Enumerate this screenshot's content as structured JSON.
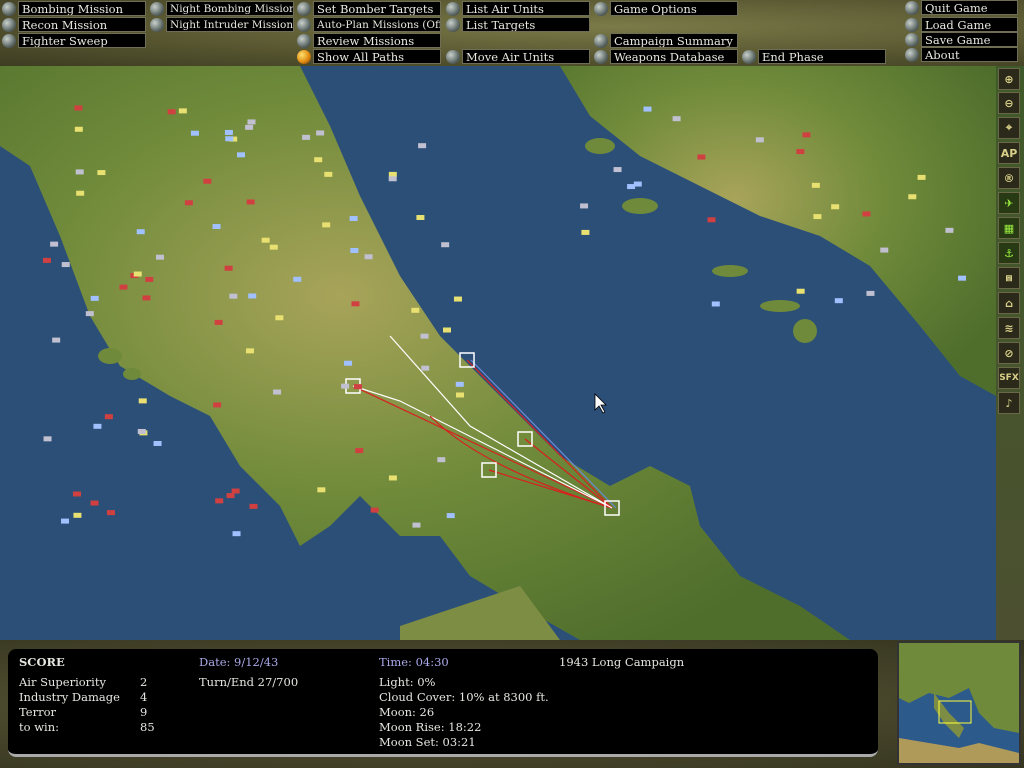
{
  "menu": {
    "bombing_mission": "Bombing Mission",
    "recon_mission": "Recon Mission",
    "fighter_sweep": "Fighter Sweep",
    "night_bombing": "Night Bombing Mission",
    "night_intruder": "Night Intruder Mission",
    "set_bomber_targets": "Set Bomber Targets",
    "auto_plan": "Auto-Plan Missions (Off)",
    "review_missions": "Review Missions",
    "show_all_paths": "Show All Paths",
    "list_air_units": "List Air Units",
    "list_targets": "List Targets",
    "move_air_units": "Move Air Units",
    "game_options": "Game Options",
    "campaign_summary": "Campaign Summary",
    "weapons_database": "Weapons Database",
    "end_phase": "End Phase",
    "quit_game": "Quit Game",
    "load_game": "Load Game",
    "save_game": "Save Game",
    "about": "About"
  },
  "toolbar": {
    "ap": "AP",
    "sfx": "SFX"
  },
  "status": {
    "score_title": "SCORE",
    "rows": [
      {
        "label": "Air Superiority",
        "value": "2"
      },
      {
        "label": "Industry Damage",
        "value": "4"
      },
      {
        "label": "Terror",
        "value": "9"
      },
      {
        "label": "to win:",
        "value": "85"
      }
    ],
    "date": "Date: 9/12/43",
    "turn": "Turn/End 27/700",
    "time": "Time: 04:30",
    "light": "Light: 0%",
    "cloud": "Cloud Cover: 10% at 8300 ft.",
    "moon": "Moon: 26",
    "moon_rise": "Moon Rise: 18:22",
    "moon_set": "Moon Set: 03:21",
    "campaign": "1943 Long Campaign"
  },
  "colors": {
    "sea": "#2c4f78",
    "land": "#6f8a3a",
    "path_red": "#d82020",
    "path_white": "#ffffff"
  }
}
